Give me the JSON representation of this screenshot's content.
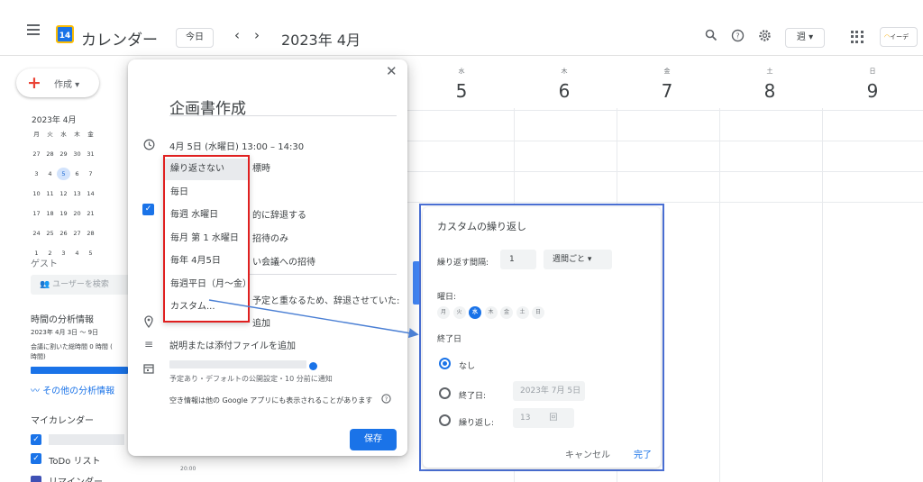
{
  "header": {
    "app_title": "カレンダー",
    "logo_day": "14",
    "today_label": "今日",
    "prev_arrow": "‹",
    "next_arrow": "›",
    "month_label": "2023年 4月",
    "view_label": "週 ▾",
    "brand_label": "イーデ"
  },
  "sidebar": {
    "create_label": "作成 ▾",
    "mini_month": "2023年 4月",
    "mini_days": [
      "月",
      "火",
      "水",
      "木",
      "金",
      "",
      ""
    ],
    "mini_rows": [
      [
        "27",
        "28",
        "29",
        "30",
        "31",
        "",
        ""
      ],
      [
        "3",
        "4",
        "5",
        "6",
        "7",
        "",
        ""
      ],
      [
        "10",
        "11",
        "12",
        "13",
        "14",
        "",
        ""
      ],
      [
        "17",
        "18",
        "19",
        "20",
        "21",
        "",
        ""
      ],
      [
        "24",
        "25",
        "26",
        "27",
        "28",
        "",
        ""
      ],
      [
        "1",
        "2",
        "3",
        "4",
        "5",
        "",
        ""
      ]
    ],
    "guest_label": "ゲスト",
    "guest_search": "ユーザーを検索",
    "analysis_title": "時間の分析情報",
    "analysis_range": "2023年 4月 3日 〜 9日",
    "analysis_summary": "会議に割いた総時間 0 時間 (",
    "analysis_summary2": "時間)",
    "analysis_more": "その他の分析情報",
    "my_calendars": "マイカレンダー",
    "todo_label": "ToDo リスト",
    "reminder_label": "リマインダー"
  },
  "calendar": {
    "days": [
      {
        "name": "水",
        "num": "5"
      },
      {
        "name": "木",
        "num": "6"
      },
      {
        "name": "金",
        "num": "7"
      },
      {
        "name": "土",
        "num": "8"
      },
      {
        "name": "日",
        "num": "9"
      }
    ],
    "time_label": "20:00"
  },
  "event_dialog": {
    "title": "企画書作成",
    "datetime": "4月 5日 (水曜日)   13:00  –  14:30",
    "timezone_fragment": "標時",
    "decline_fragment": "的に辞退する",
    "invite_only_fragment": "招待のみ",
    "meeting_fragment": "い会議への招待",
    "decline_message": "予定と重なるため、辞退させていた:",
    "location_fragment": "追加",
    "description": "説明または添付ファイルを追加",
    "visibility_note": "予定あり・デフォルトの公開設定・10 分前に通知",
    "availability_note": "空き情報は他の Google アプリにも表示されることがあります",
    "save_label": "保存"
  },
  "repeat_menu": {
    "items": [
      "繰り返さない",
      "毎日",
      "毎週 水曜日",
      "毎月 第 1 水曜日",
      "毎年 4月5日",
      "毎週平日（月〜金）",
      "カスタム..."
    ],
    "highlight_color": "#e02020"
  },
  "custom_repeat": {
    "title": "カスタムの繰り返し",
    "interval_label": "繰り返す間隔:",
    "interval_value": "1",
    "interval_unit": "週間ごと  ▾",
    "weekday_label": "曜日:",
    "weekdays": [
      "月",
      "火",
      "水",
      "木",
      "金",
      "土",
      "日"
    ],
    "end_label": "終了日",
    "end_none": "なし",
    "end_date_label": "終了日:",
    "end_date_value": "2023年 7月 5日",
    "end_count_label": "繰り返し:",
    "end_count_value": "13",
    "end_count_unit": "回",
    "cancel_label": "キャンセル",
    "done_label": "完了",
    "frame_color": "#4a6fd3"
  }
}
